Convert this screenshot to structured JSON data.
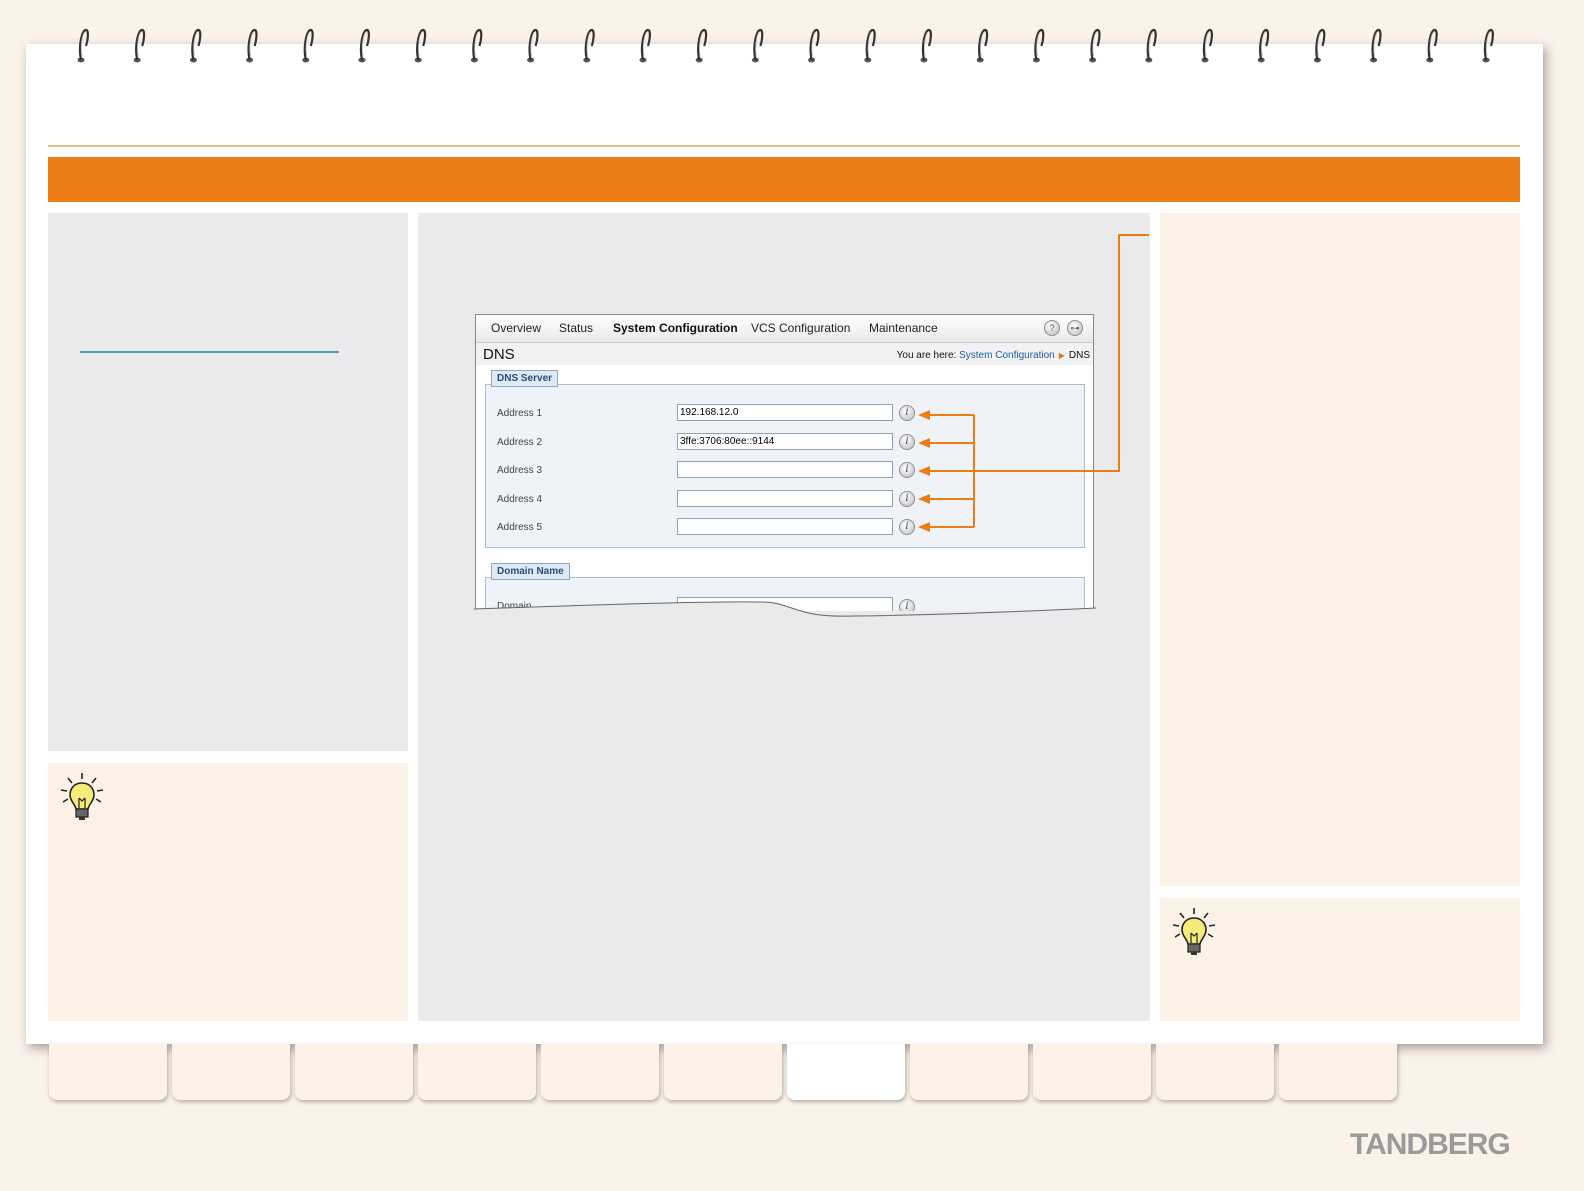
{
  "navigation": {
    "items": [
      "Overview",
      "Status",
      "System Configuration",
      "VCS Configuration",
      "Maintenance"
    ],
    "active": "System Configuration",
    "help_icon": "question-mark-icon",
    "logout_icon": "key-icon"
  },
  "page": {
    "title": "DNS",
    "breadcrumb_prefix": "You are here:",
    "breadcrumb_link": "System Configuration",
    "breadcrumb_current": "DNS"
  },
  "dns_server": {
    "legend": "DNS Server",
    "rows": [
      {
        "label": "Address 1",
        "value": "192.168.12.0"
      },
      {
        "label": "Address 2",
        "value": "3ffe:3706:80ee::9144"
      },
      {
        "label": "Address 3",
        "value": ""
      },
      {
        "label": "Address 4",
        "value": ""
      },
      {
        "label": "Address 5",
        "value": ""
      }
    ]
  },
  "domain_name": {
    "legend": "Domain Name",
    "label": "Domain",
    "value": ""
  },
  "brand": {
    "logo_text": "TANDBERG"
  },
  "colors": {
    "accent_orange": "#ea7d14",
    "link_blue": "#4fa2c6"
  }
}
